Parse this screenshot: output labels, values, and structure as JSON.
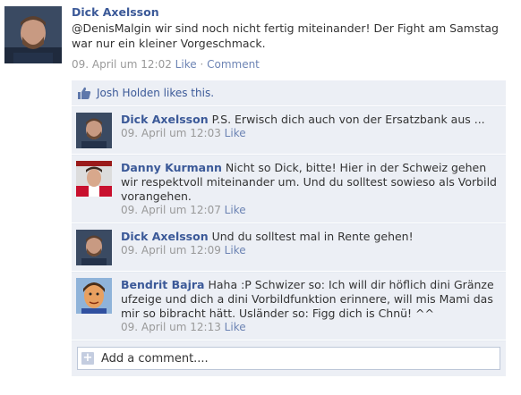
{
  "post": {
    "author": "Dick Axelsson",
    "text": "@DenisMalgin wir sind noch nicht fertig miteinander! Der Fight am Samstag war nur ein kleiner Vorgeschmack.",
    "timestamp": "09. April um 12:02",
    "like_label": "Like",
    "comment_label": "Comment",
    "separator": "·"
  },
  "likes": {
    "text": "Josh Holden likes this."
  },
  "comments": [
    {
      "author": "Dick Axelsson",
      "text": "P.S. Erwisch dich auch von der Ersatzbank aus ...",
      "timestamp": "09. April um 12:03",
      "like_label": "Like"
    },
    {
      "author": "Danny Kurmann",
      "text": "Nicht so Dick, bitte! Hier in der Schweiz gehen wir respektvoll miteinander um. Und du solltest sowieso als Vorbild vorangehen.",
      "timestamp": "09. April um 12:07",
      "like_label": "Like"
    },
    {
      "author": "Dick Axelsson",
      "text": "Und du solltest mal in Rente gehen!",
      "timestamp": "09. April um 12:09",
      "like_label": "Like"
    },
    {
      "author": "Bendrit Bajra",
      "text": "Haha :P Schwizer so: Ich will dir höflich dini Gränze ufzeige und dich a dini Vorbildfunktion erinnere, will mis Mami das mir so bibracht hätt. Usländer so: Figg dich is Chnü! ^^",
      "timestamp": "09. April um 12:13",
      "like_label": "Like"
    }
  ],
  "add_comment": {
    "label": "Add a comment...."
  }
}
